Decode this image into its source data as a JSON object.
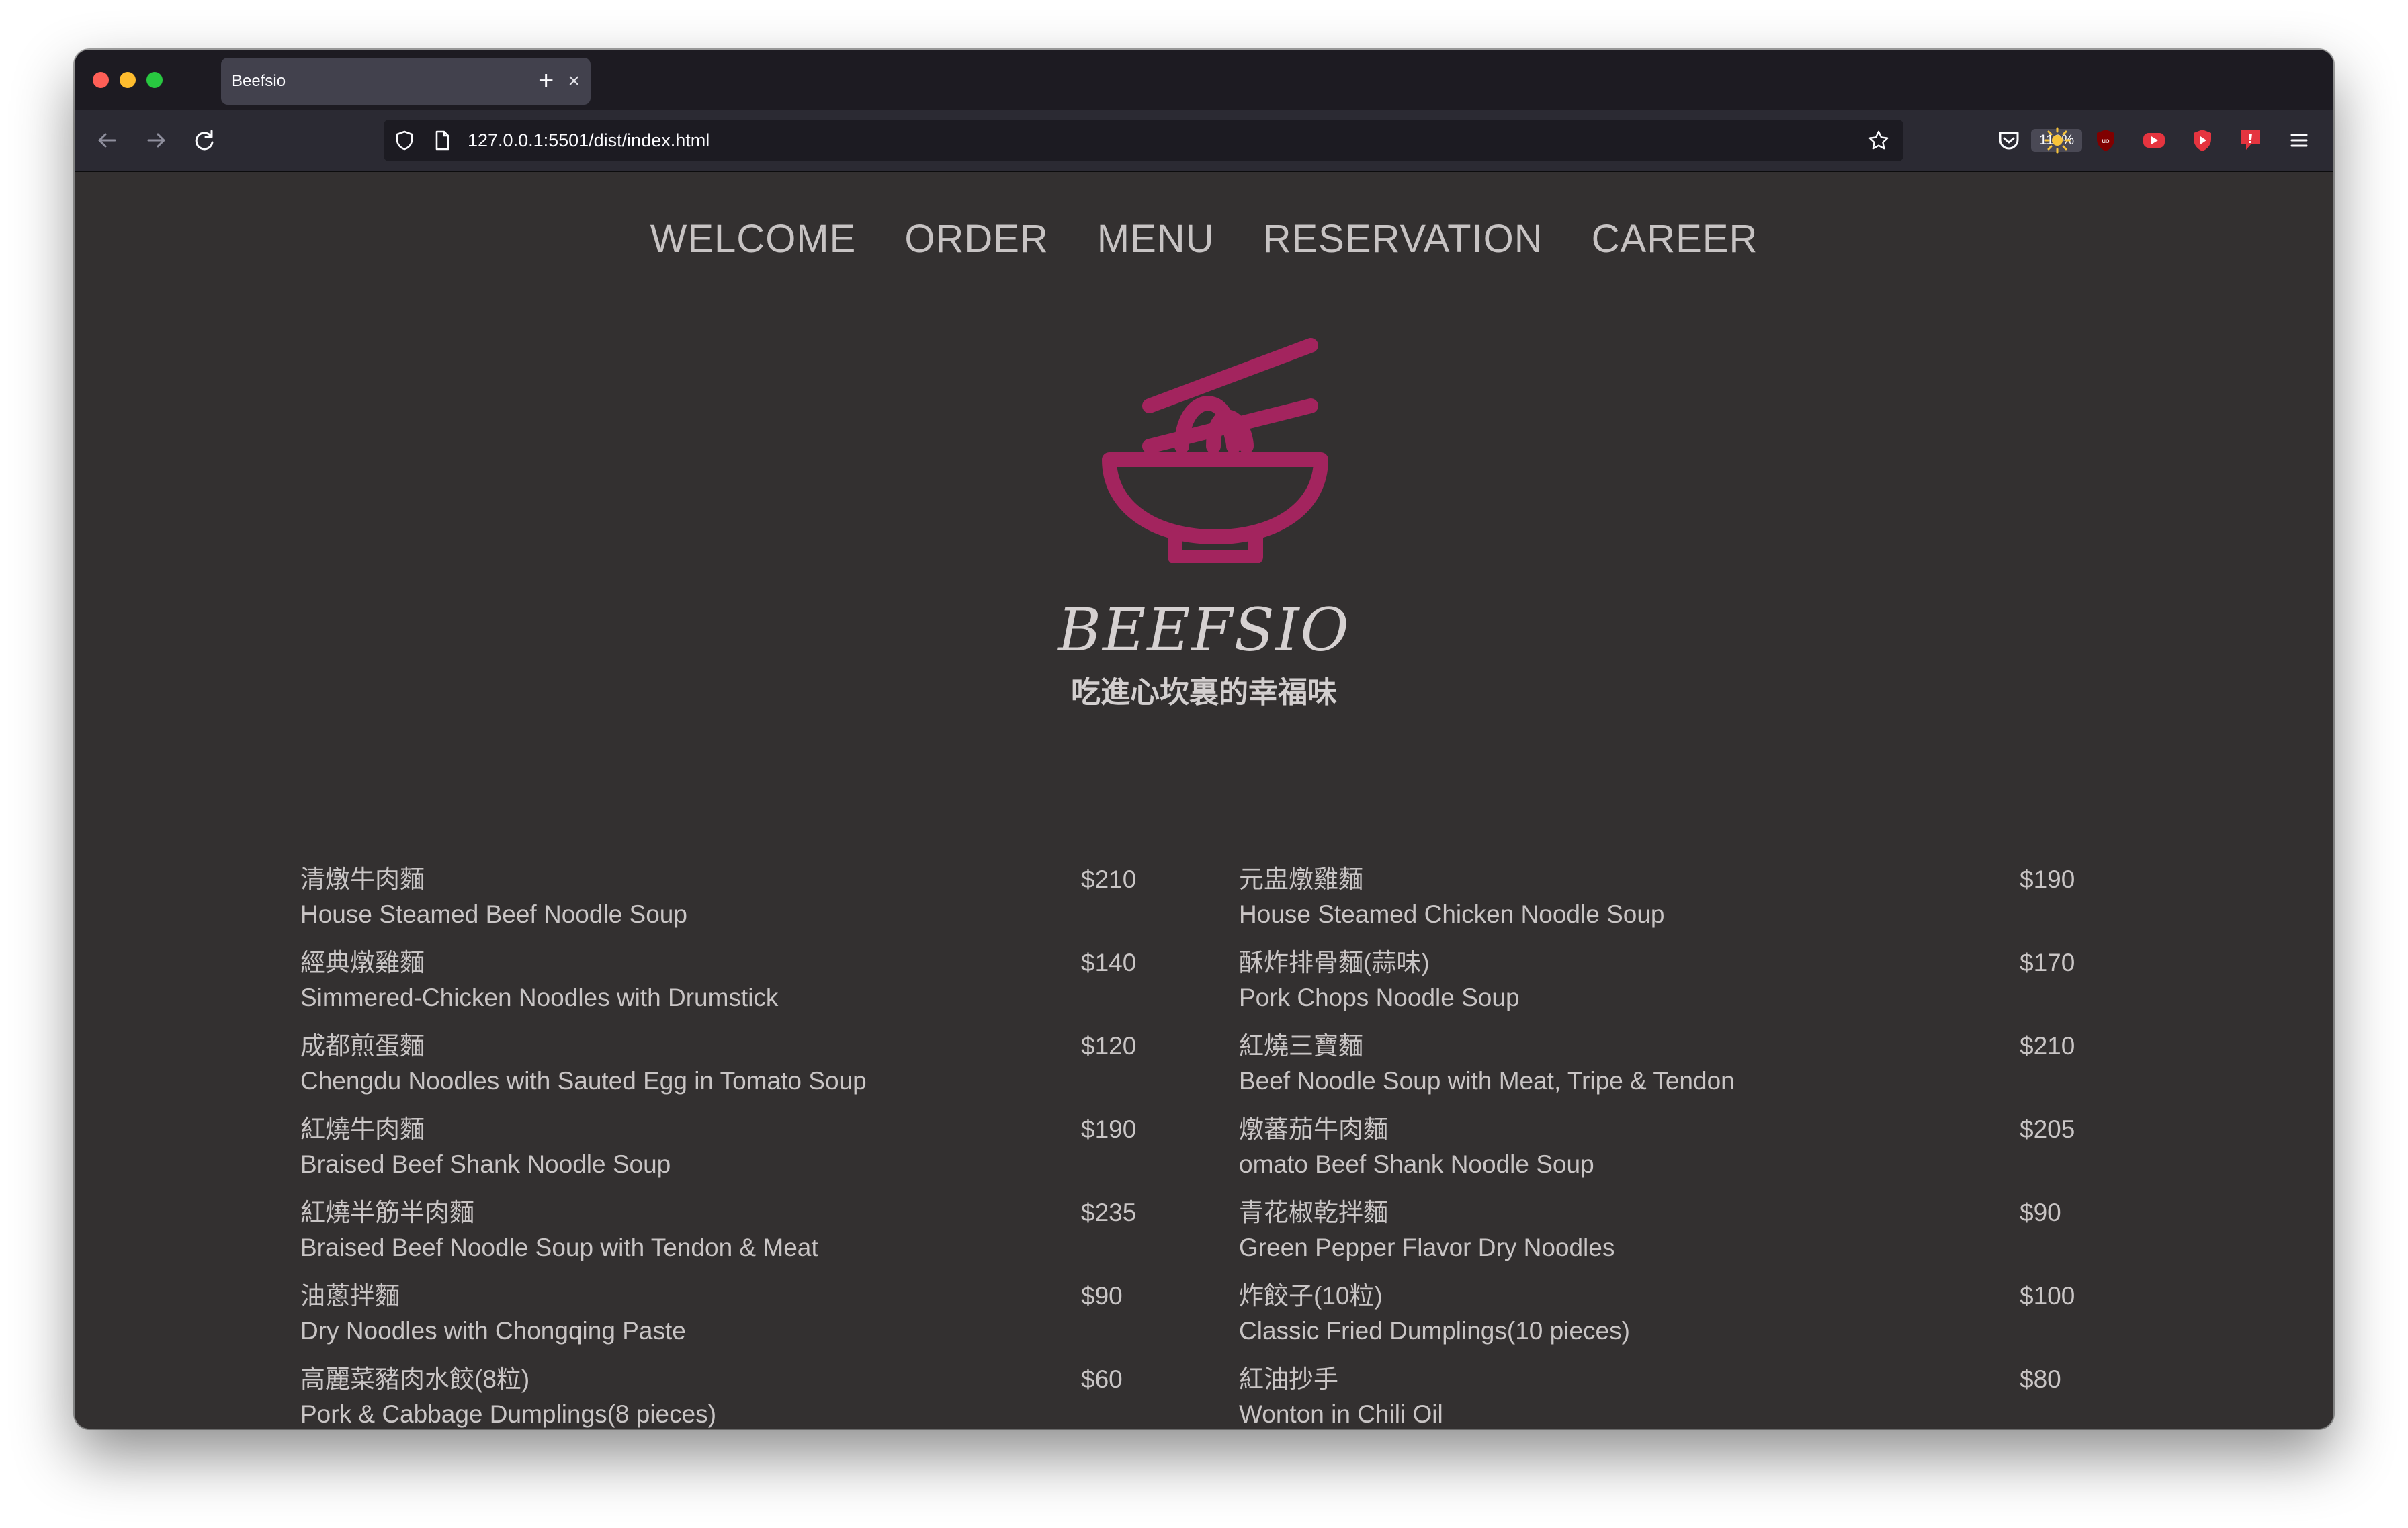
{
  "browser": {
    "tab_title": "Beefsio",
    "tab_close": "×",
    "new_tab": "+",
    "url": "127.0.0.1:5501/dist/index.html",
    "zoom": "110%",
    "icons": [
      "back-arrow-icon",
      "forward-arrow-icon",
      "reload-icon",
      "shield-icon",
      "page-icon",
      "star-icon",
      "pocket-icon",
      "sun-icon",
      "ublock-icon",
      "youtube-ext-icon",
      "youtube-red-icon",
      "dislike-icon",
      "hamburger-menu-icon"
    ]
  },
  "site_nav": [
    "WELCOME",
    "ORDER",
    "MENU",
    "RESERVATION",
    "CAREER"
  ],
  "brand": {
    "name": "BEEFSIO",
    "tagline": "吃進心坎裏的幸福味",
    "logo_color": "#a3245e"
  },
  "menu_left": [
    {
      "zh": "清燉牛肉麵",
      "en": "House Steamed Beef Noodle Soup",
      "price": "$210"
    },
    {
      "zh": "經典燉雞麵",
      "en": "Simmered-Chicken Noodles with Drumstick",
      "price": "$140"
    },
    {
      "zh": "成都煎蛋麵",
      "en": "Chengdu Noodles with Sauted Egg in Tomato Soup",
      "price": "$120"
    },
    {
      "zh": "紅燒牛肉麵",
      "en": "Braised Beef Shank Noodle Soup",
      "price": "$190"
    },
    {
      "zh": "紅燒半筋半肉麵",
      "en": "Braised Beef Noodle Soup with Tendon & Meat",
      "price": "$235"
    },
    {
      "zh": "油蔥拌麵",
      "en": "Dry Noodles with Chongqing Paste",
      "price": "$90"
    },
    {
      "zh": "高麗菜豬肉水餃(8粒)",
      "en": "Pork & Cabbage Dumplings(8 pieces)",
      "price": "$60"
    }
  ],
  "menu_right": [
    {
      "zh": "元盅燉雞麵",
      "en": "House Steamed Chicken Noodle Soup",
      "price": "$190"
    },
    {
      "zh": "酥炸排骨麵(蒜味)",
      "en": "Pork Chops Noodle Soup",
      "price": "$170"
    },
    {
      "zh": "紅燒三寶麵",
      "en": "Beef Noodle Soup with Meat, Tripe & Tendon",
      "price": "$210"
    },
    {
      "zh": "燉蕃茄牛肉麵",
      "en": "omato Beef Shank Noodle Soup",
      "price": "$205"
    },
    {
      "zh": "青花椒乾拌麵",
      "en": "Green Pepper Flavor Dry Noodles",
      "price": "$90"
    },
    {
      "zh": "炸餃子(10粒)",
      "en": "Classic Fried Dumplings(10 pieces)",
      "price": "$100"
    },
    {
      "zh": "紅油抄手",
      "en": "Wonton in Chili Oil",
      "price": "$80"
    }
  ]
}
